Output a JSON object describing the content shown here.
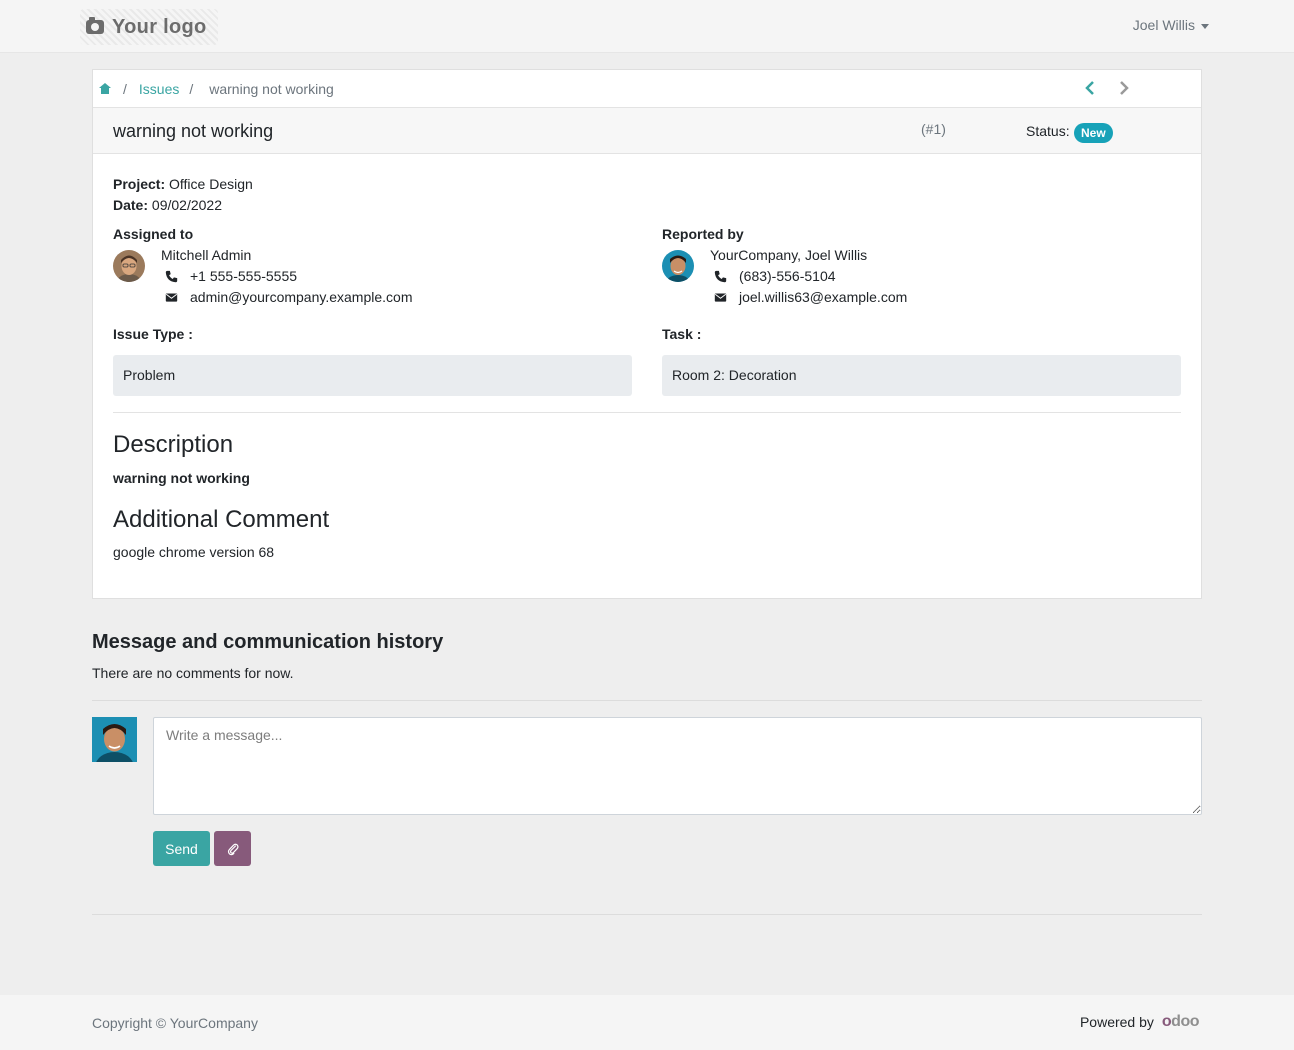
{
  "header": {
    "logo_text": "Your logo",
    "user_name": "Joel Willis"
  },
  "breadcrumb": {
    "sep": "/",
    "items": [
      "Issues",
      "warning not working"
    ]
  },
  "issue": {
    "title": "warning not working",
    "number": "(#1)",
    "status_label": "Status:",
    "status": "New",
    "project_label": "Project:",
    "project": "Office Design",
    "date_label": "Date:",
    "date": "09/02/2022"
  },
  "assigned": {
    "label": "Assigned to",
    "name": "Mitchell Admin",
    "phone": "+1 555-555-5555",
    "email": "admin@yourcompany.example.com"
  },
  "reported": {
    "label": "Reported by",
    "name": "YourCompany, Joel Willis",
    "phone": "(683)-556-5104",
    "email": "joel.willis63@example.com"
  },
  "issue_type": {
    "label": "Issue Type :",
    "value": "Problem"
  },
  "task": {
    "label": "Task :",
    "value": "Room 2: Decoration"
  },
  "description": {
    "heading": "Description",
    "text": "warning not working"
  },
  "comment": {
    "heading": "Additional Comment",
    "text": "google chrome version 68"
  },
  "history": {
    "heading": "Message and communication history",
    "empty": "There are no comments for now.",
    "placeholder": "Write a message...",
    "send_label": "Send"
  },
  "footer": {
    "copyright": "Copyright © YourCompany",
    "powered_by": "Powered by",
    "brand_part1": "o",
    "brand_part2": "doo"
  },
  "colors": {
    "accent": "#3aa5a3",
    "badge": "#17a2b8",
    "attach": "#875a7b"
  }
}
